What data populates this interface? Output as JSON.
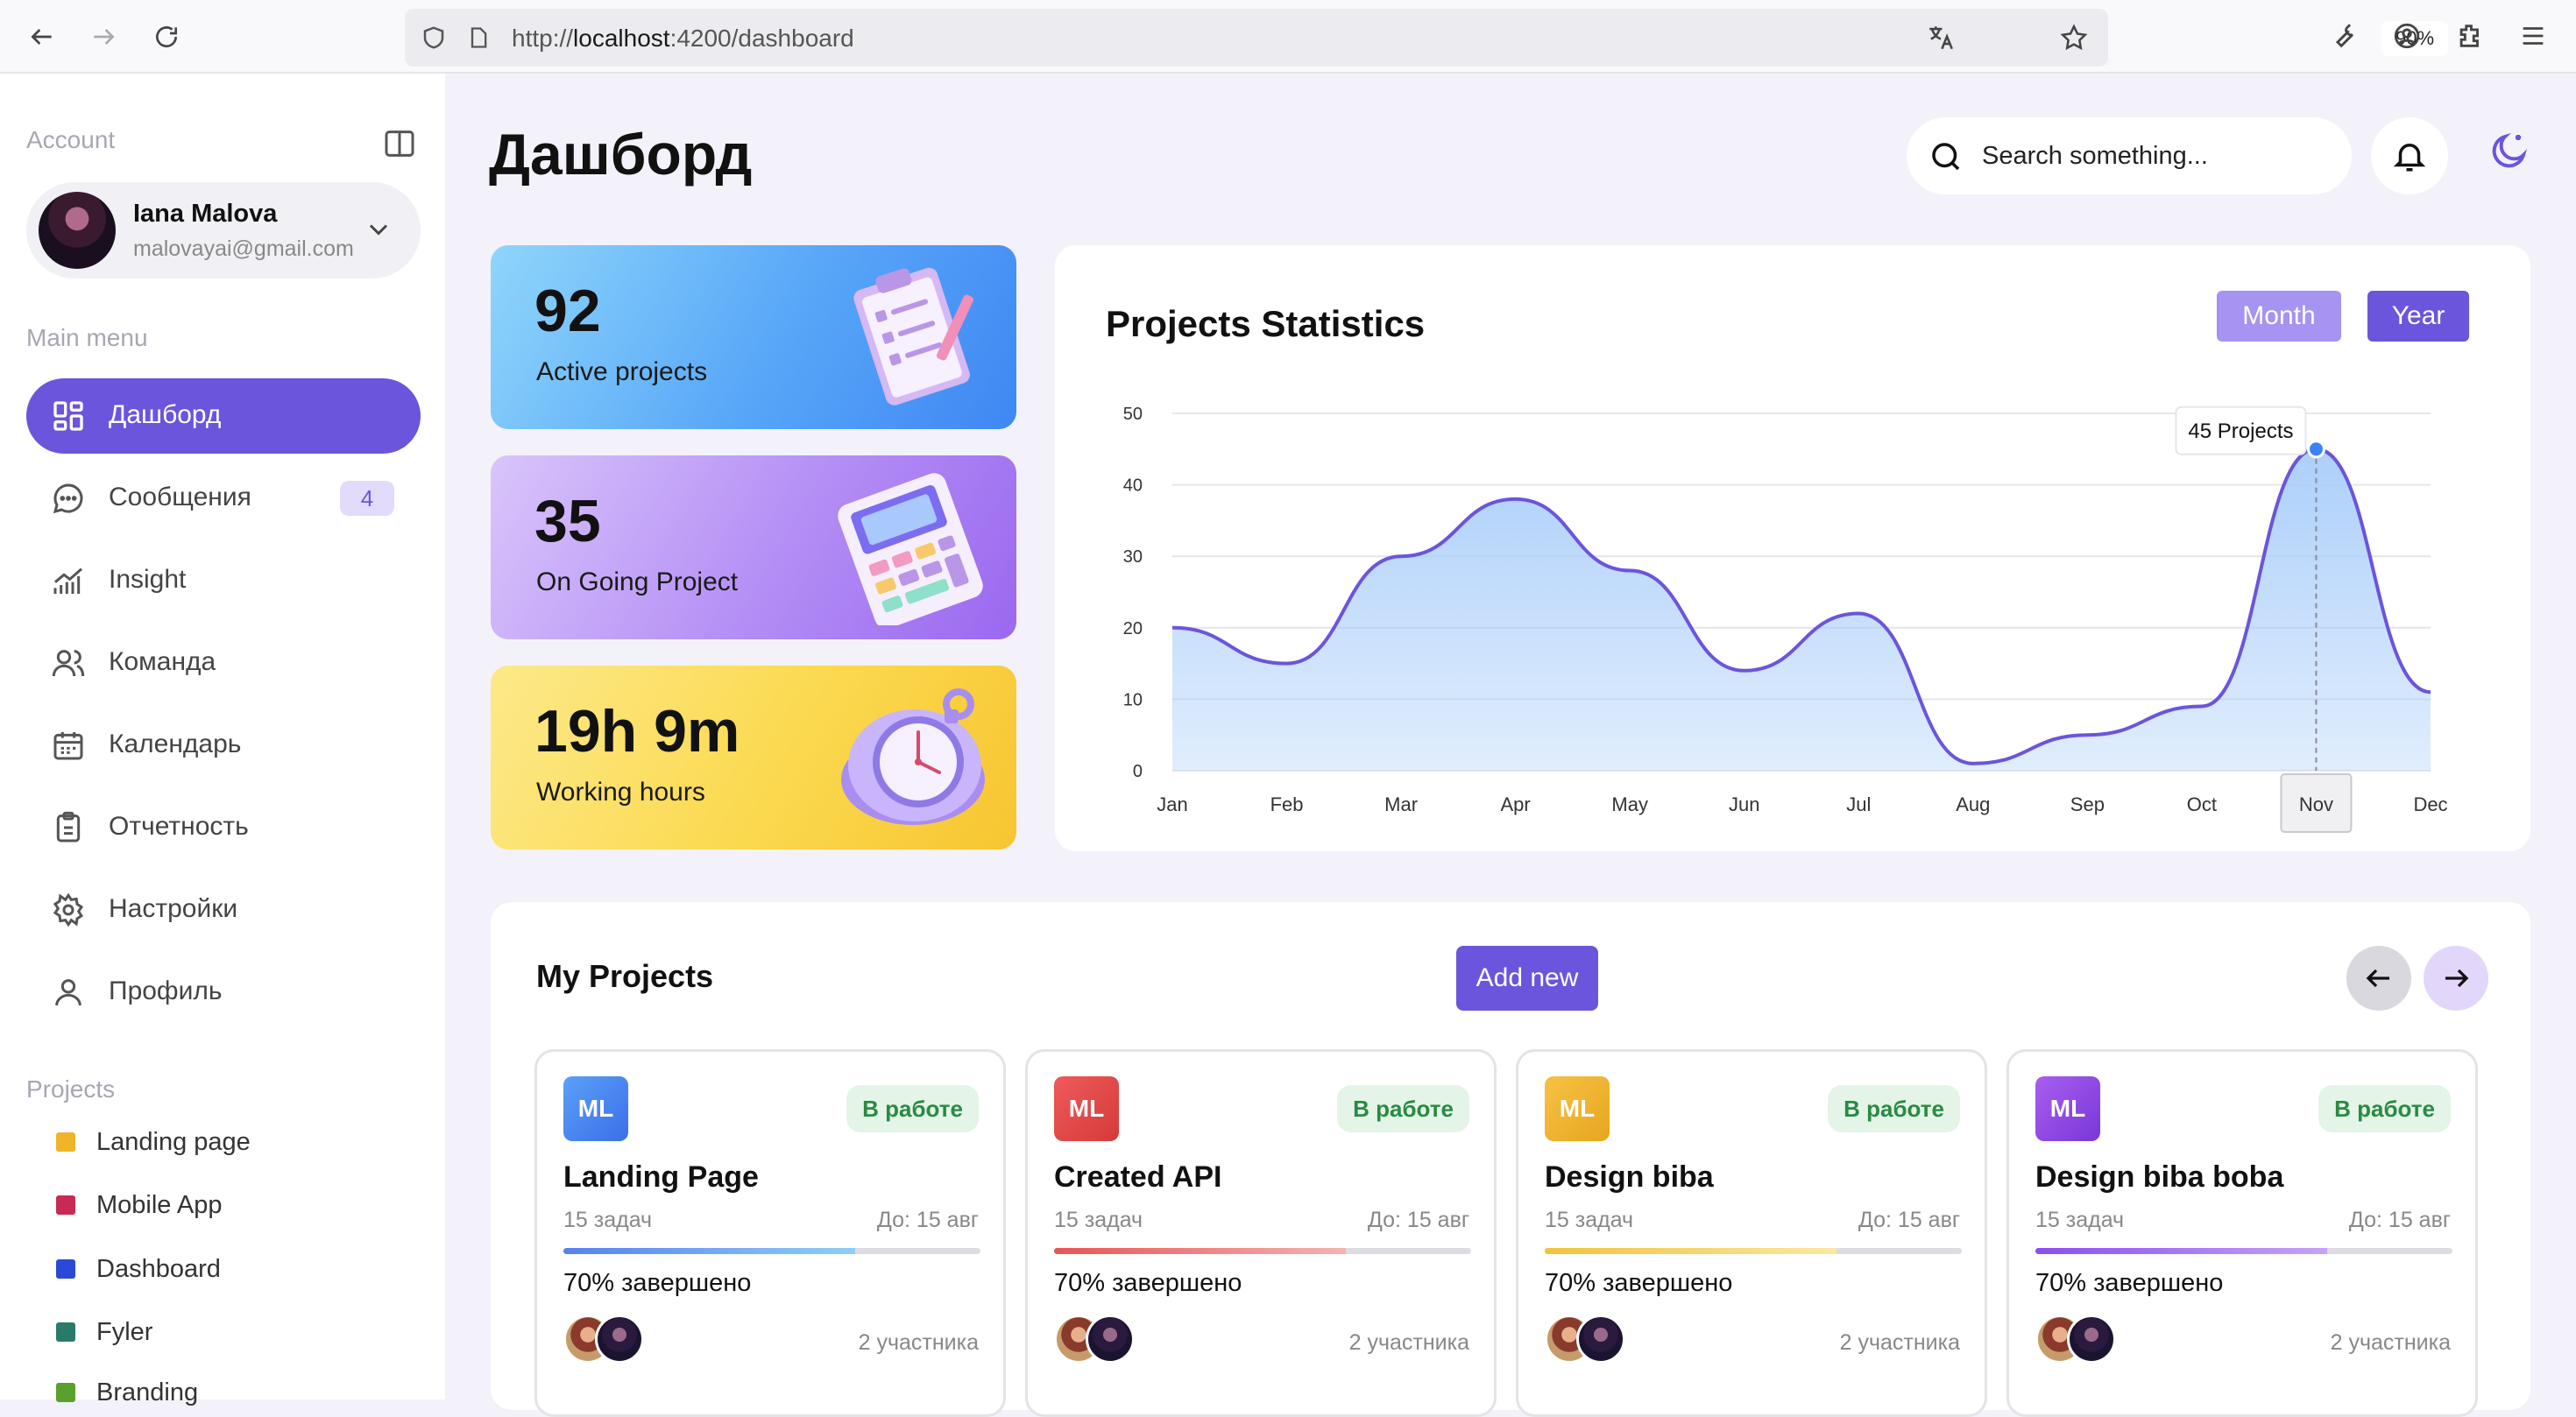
{
  "browser": {
    "url_prefix": "http://",
    "url_host": "localhost",
    "url_rest": ":4200/dashboard",
    "zoom": "90%"
  },
  "sidebar": {
    "account_label": "Account",
    "user_name": "Iana Malova",
    "user_email": "malovayai@gmail.com",
    "main_menu_label": "Main menu",
    "items": [
      {
        "label": "Дашборд",
        "icon": "dashboard-icon"
      },
      {
        "label": "Сообщения",
        "icon": "chat-icon",
        "badge": "4"
      },
      {
        "label": "Insight",
        "icon": "insight-chart-icon"
      },
      {
        "label": "Команда",
        "icon": "team-icon"
      },
      {
        "label": "Календарь",
        "icon": "calendar-icon"
      },
      {
        "label": "Отчетность",
        "icon": "clipboard-icon"
      },
      {
        "label": "Настройки",
        "icon": "gear-icon"
      },
      {
        "label": "Профиль",
        "icon": "user-icon"
      }
    ],
    "projects_label": "Projects",
    "projects": [
      {
        "label": "Landing page",
        "color": "#f0b429"
      },
      {
        "label": "Mobile App",
        "color": "#c92a55"
      },
      {
        "label": "Dashboard",
        "color": "#2b49d6"
      },
      {
        "label": "Fyler",
        "color": "#2a7a6a"
      },
      {
        "label": "Branding",
        "color": "#5aa02c"
      }
    ]
  },
  "header": {
    "title": "Дашборд",
    "search_placeholder": "Search something..."
  },
  "stats": [
    {
      "value": "92",
      "label": "Active projects"
    },
    {
      "value": "35",
      "label": "On Going Project"
    },
    {
      "value": "19h 9m",
      "label": "Working hours"
    }
  ],
  "chart_card": {
    "title": "Projects Statistics",
    "month_label": "Month",
    "year_label": "Year",
    "tooltip": "45 Projects"
  },
  "chart_data": {
    "type": "area",
    "title": "Projects Statistics",
    "categories": [
      "Jan",
      "Feb",
      "Mar",
      "Apr",
      "May",
      "Jun",
      "Jul",
      "Aug",
      "Sep",
      "Oct",
      "Nov",
      "Dec"
    ],
    "values": [
      20,
      15,
      30,
      38,
      28,
      14,
      22,
      1,
      5,
      9,
      45,
      11
    ],
    "yticks": [
      0,
      10,
      20,
      30,
      40,
      50
    ],
    "ylim": [
      0,
      50
    ],
    "highlight": "Nov",
    "colors": {
      "line": "#6b55dc",
      "fill": "#a8cdfa",
      "point": "#3b82f6"
    },
    "grid": true
  },
  "my_projects": {
    "title": "My Projects",
    "add_label": "Add new",
    "cards": [
      {
        "logo": "ML",
        "status": "В работе",
        "name": "Landing Page",
        "tasks": "15 задач",
        "due": "До: 15 авг",
        "progress": 0.7,
        "progress_text": "70% завершено",
        "members": "2 участника"
      },
      {
        "logo": "ML",
        "status": "В работе",
        "name": "Created API",
        "tasks": "15 задач",
        "due": "До: 15 авг",
        "progress": 0.7,
        "progress_text": "70% завершено",
        "members": "2 участника"
      },
      {
        "logo": "ML",
        "status": "В работе",
        "name": "Design biba",
        "tasks": "15 задач",
        "due": "До: 15 авг",
        "progress": 0.7,
        "progress_text": "70% завершено",
        "members": "2 участника"
      },
      {
        "logo": "ML",
        "status": "В работе",
        "name": "Design biba boba",
        "tasks": "15 задач",
        "due": "До: 15 авг",
        "progress": 0.7,
        "progress_text": "70% завершено",
        "members": "2 участника"
      }
    ]
  }
}
